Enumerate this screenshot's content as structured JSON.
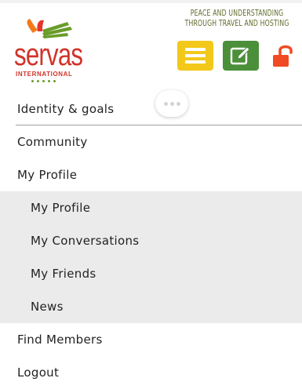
{
  "header": {
    "brand_word": "servas",
    "brand_sub": "INTERNATIONAL",
    "tagline_line1": "PEACE AND UNDERSTANDING",
    "tagline_line2": "THROUGH TRAVEL AND HOSTING",
    "menu_icon": "hamburger-icon",
    "edit_icon": "edit-icon",
    "lock_icon": "unlocked-padlock-icon"
  },
  "colors": {
    "brand_red": "#d0342c",
    "menu_button": "#f2c81b",
    "edit_button": "#4c8f3a",
    "lock": "#f04a23",
    "submenu_bg": "#ebebeb"
  },
  "overflow_button": {
    "icon": "more-dots-icon"
  },
  "menu": {
    "items": [
      {
        "label": "Identity & goals"
      },
      {
        "label": "Community"
      },
      {
        "label": "My Profile"
      }
    ],
    "submenu": [
      {
        "label": "My Profile"
      },
      {
        "label": "My Conversations"
      },
      {
        "label": "My Friends"
      },
      {
        "label": "News"
      }
    ],
    "bottom_items": [
      {
        "label": "Find Members"
      },
      {
        "label": "Logout"
      }
    ]
  }
}
